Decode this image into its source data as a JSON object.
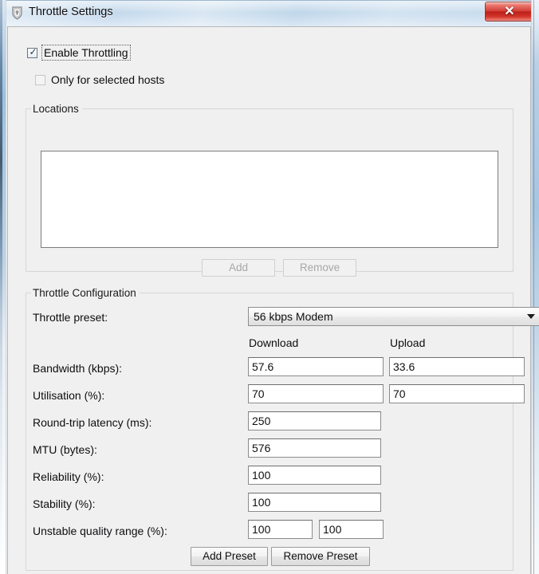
{
  "window": {
    "title": "Throttle Settings",
    "icon": "app-shield-icon",
    "close_label": "✕",
    "titlebar_color": "#c9dcee",
    "close_button_color": "#c9302c"
  },
  "checkboxes": {
    "enable_throttling": {
      "label": "Enable Throttling",
      "checked": true,
      "focused": true,
      "tick": "✓"
    },
    "only_selected_hosts": {
      "label": "Only for selected hosts",
      "checked": false,
      "enabled": false,
      "tick": ""
    }
  },
  "locations_group": {
    "title": "Locations",
    "list_items": [],
    "add_button": "Add",
    "remove_button": "Remove",
    "add_enabled": false,
    "remove_enabled": false
  },
  "throttle_config": {
    "title": "Throttle Configuration",
    "preset_label": "Throttle preset:",
    "preset_value": "56 kbps Modem",
    "preset_options": [
      "56 kbps Modem"
    ],
    "column_headers": {
      "download": "Download",
      "upload": "Upload"
    },
    "rows": [
      {
        "label": "Bandwidth (kbps):",
        "download": "57.6",
        "upload": "33.6"
      },
      {
        "label": "Utilisation (%):",
        "download": "70",
        "upload": "70"
      },
      {
        "label": "Round-trip latency (ms):",
        "download": "250",
        "upload": null
      },
      {
        "label": "MTU (bytes):",
        "download": "576",
        "upload": null
      },
      {
        "label": "Reliability (%):",
        "download": "100",
        "upload": null
      },
      {
        "label": "Stability (%):",
        "download": "100",
        "upload": null
      },
      {
        "label": "Unstable quality range (%):",
        "download": "100",
        "upload": "100"
      }
    ],
    "add_preset_button": "Add Preset",
    "remove_preset_button": "Remove Preset"
  }
}
